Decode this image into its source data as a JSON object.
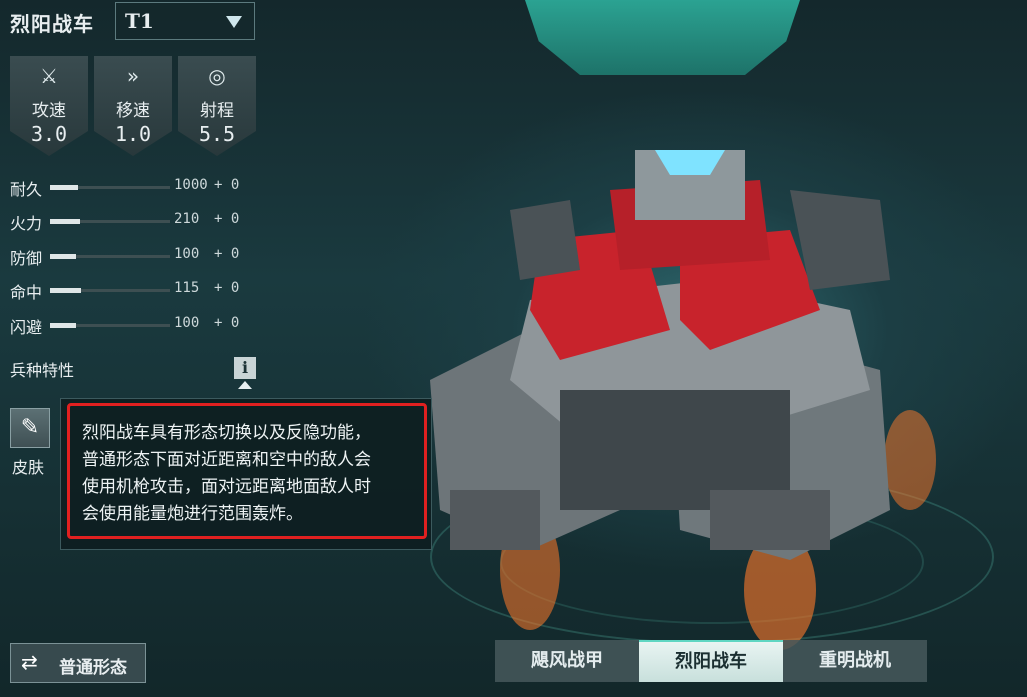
{
  "header": {
    "unit_name": "烈阳战车",
    "tier": "T1"
  },
  "stats": [
    {
      "icon": "attack-speed-icon",
      "label": "攻速",
      "value": "3.0"
    },
    {
      "icon": "move-speed-icon",
      "label": "移速",
      "value": "1.0"
    },
    {
      "icon": "range-icon",
      "label": "射程",
      "value": "5.5"
    }
  ],
  "attributes": [
    {
      "label": "耐久",
      "value": "1000",
      "bonus": "+ 0"
    },
    {
      "label": "火力",
      "value": "210",
      "bonus": "+ 0"
    },
    {
      "label": "防御",
      "value": "100",
      "bonus": "+ 0"
    },
    {
      "label": "命中",
      "value": "115",
      "bonus": "+ 0"
    },
    {
      "label": "闪避",
      "value": "100",
      "bonus": "+ 0"
    }
  ],
  "trait": {
    "label": "兵种特性",
    "info_glyph": "i"
  },
  "skin": {
    "label": "皮肤"
  },
  "tooltip": {
    "text": "烈阳战车具有形态切换以及反隐功能，\n普通形态下面对近距离和空中的敌人会\n使用机枪攻击，面对远距离地面敌人时\n会使用能量炮进行范围轰炸。"
  },
  "form_button": {
    "label": "普通形态"
  },
  "tabs": [
    {
      "label": "飓风战甲",
      "active": false
    },
    {
      "label": "烈阳战车",
      "active": true
    },
    {
      "label": "重明战机",
      "active": false
    }
  ],
  "colors": {
    "accent": "#5fd6c2",
    "highlight_border": "#e02020",
    "mech_red": "#c8232c"
  }
}
